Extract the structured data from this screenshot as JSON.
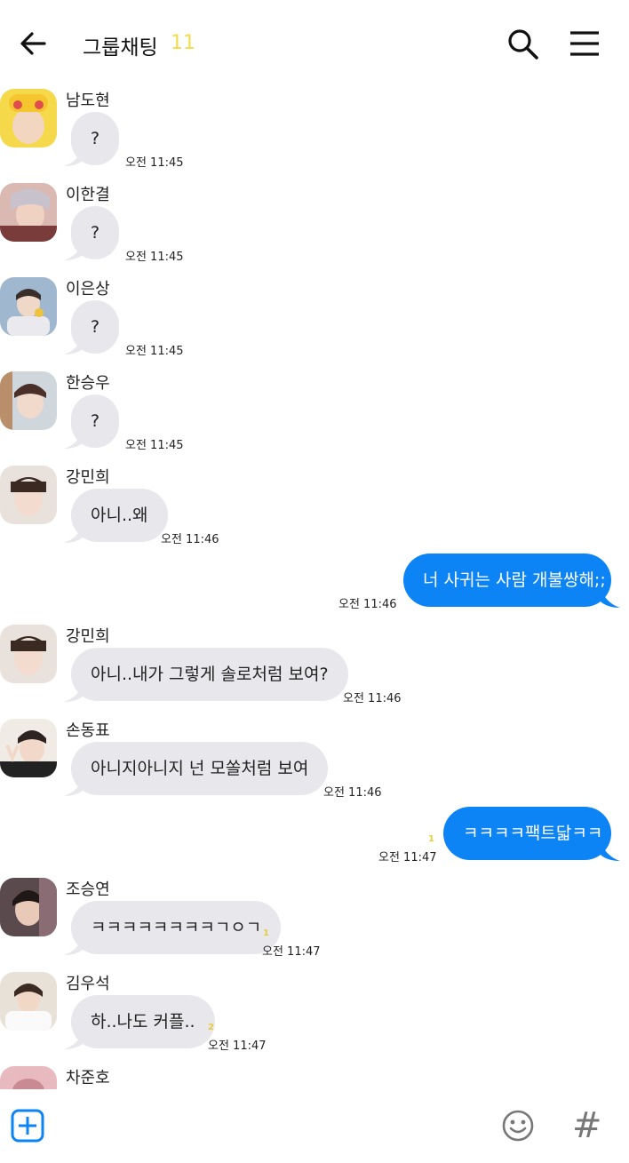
{
  "header": {
    "title": "그룹채팅",
    "count": "11"
  },
  "messages": [
    {
      "sender": "남도현",
      "text": "?",
      "time": "오전 11:45"
    },
    {
      "sender": "이한결",
      "text": "?",
      "time": "오전 11:45"
    },
    {
      "sender": "이은상",
      "text": "?",
      "time": "오전 11:45"
    },
    {
      "sender": "한승우",
      "text": "?",
      "time": "오전 11:45"
    },
    {
      "sender": "강민희",
      "text": "아니..왜",
      "time": "오전 11:46"
    },
    {
      "text": "너 사귀는 사람 개불쌍해;;",
      "time": "오전 11:46"
    },
    {
      "sender": "강민희",
      "text": "아니..내가 그렇게 솔로처럼 보여?",
      "time": "오전 11:46"
    },
    {
      "sender": "손동표",
      "text": "아니지아니지 넌 모쏠처럼 보여",
      "time": "오전 11:46"
    },
    {
      "text": "ㅋㅋㅋㅋ팩트닯ㅋㅋ",
      "time": "오전 11:47",
      "unread": "1"
    },
    {
      "sender": "조승연",
      "text": "ㅋㅋㅋㅋㅋㅋㅋㅋㄱㅇㄱ",
      "time": "오전 11:47",
      "unread": "1"
    },
    {
      "sender": "김우석",
      "text": "하..나도 커플..",
      "time": "오전 11:47",
      "unread": "2"
    },
    {
      "sender": "차준호"
    }
  ],
  "colors": {
    "accent_blue": "#0d84f5",
    "incoming_bubble": "#e7e7ec",
    "unread_yellow": "#e6cd3a"
  }
}
